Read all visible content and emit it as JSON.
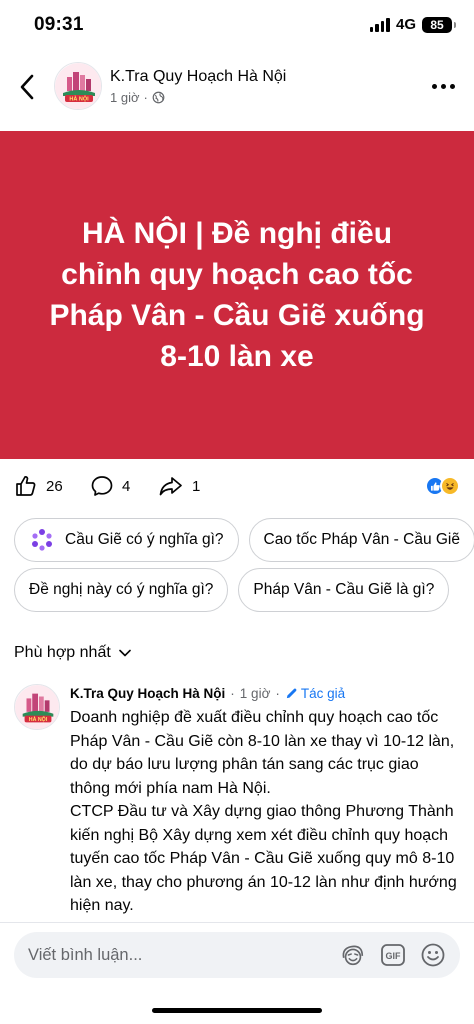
{
  "status_bar": {
    "time": "09:31",
    "network": "4G",
    "battery": "85"
  },
  "header": {
    "page_name": "K.Tra Quy Hoạch Hà Nội",
    "time": "1 giờ",
    "separator": "·"
  },
  "avatar_text": "HÀ NỘI",
  "banner": {
    "title": "HÀ NỘI | Đề nghị điều chỉnh quy hoạch cao tốc Pháp Vân - Cầu Giẽ xuống 8-10 làn xe",
    "background": "#cc2a3e"
  },
  "reactions": {
    "likes": "26",
    "comments": "4",
    "shares": "1"
  },
  "suggestions": {
    "row1": [
      "Cầu Giẽ có ý nghĩa gì?",
      "Cao tốc Pháp Vân - Cầu Giẽ"
    ],
    "row2": [
      "Đề nghị này có ý nghĩa gì?",
      "Pháp Vân - Cầu Giẽ là gì?"
    ]
  },
  "sort_label": "Phù hợp nhất",
  "comment": {
    "author": "K.Tra Quy Hoạch Hà Nội",
    "separator": "·",
    "time": "1 giờ",
    "badge": "Tác giả",
    "body_1": "Doanh nghiệp đề xuất điều chỉnh quy hoạch cao tốc Pháp Vân - Cầu Giẽ còn 8-10 làn xe thay vì 10-12 làn, do dự báo lưu lượng phân tán sang các trục giao thông mới phía nam Hà Nội.",
    "body_2": "CTCP Đầu tư và Xây dựng giao thông Phương Thành kiến nghị Bộ Xây dựng xem xét điều chỉnh quy hoạch tuyến cao tốc Pháp Vân - Cầu Giẽ xuống quy mô 8-10 làn xe, thay cho phương án 10-12 làn như định hướng hiện nay."
  },
  "comment_input": {
    "placeholder": "Viết bình luận..."
  },
  "icons": {
    "back": "chevron-left-icon",
    "more": "more-horizontal-icon",
    "globe": "globe-icon",
    "like": "thumbs-up-icon",
    "comment": "comment-bubble-icon",
    "share": "share-arrow-icon",
    "sparkle": "meta-ai-sparkle-icon",
    "chevron": "chevron-down-icon",
    "pencil": "pencil-icon",
    "avatar_sticker": "avatar-sticker-icon",
    "gif": "gif-icon",
    "emoji": "smiley-icon"
  },
  "colors": {
    "accent": "#1877f2",
    "banner": "#cc2a3e",
    "secondary_text": "#65676b"
  }
}
